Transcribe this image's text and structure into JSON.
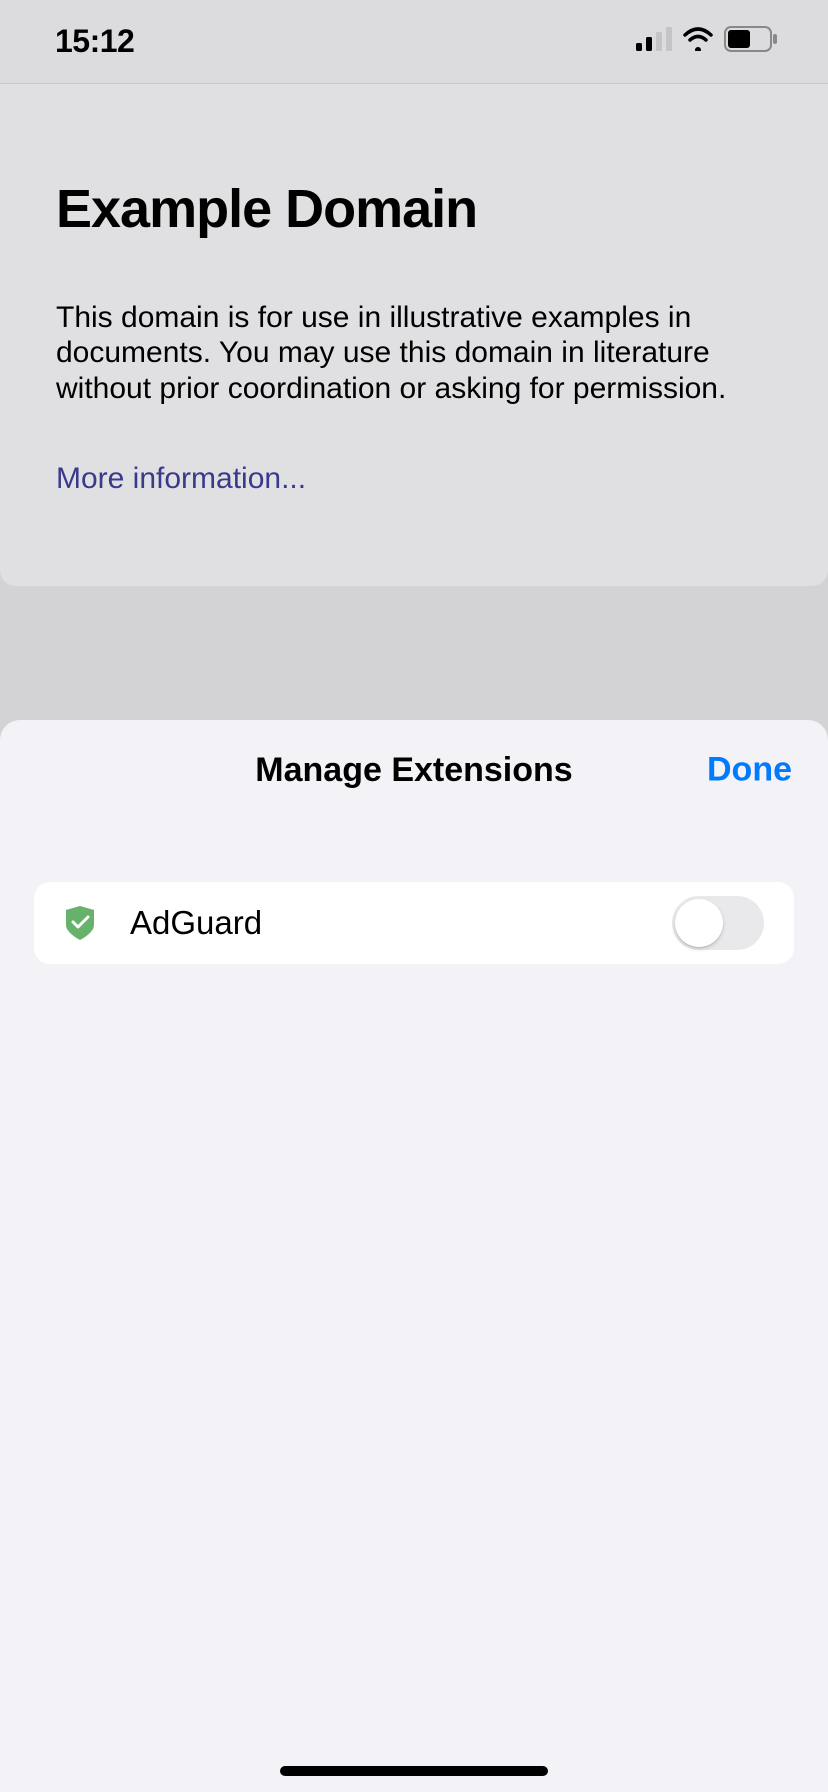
{
  "status_bar": {
    "time": "15:12"
  },
  "page": {
    "title": "Example Domain",
    "body": "This domain is for use in illustrative examples in documents. You may use this domain in literature without prior coordination or asking for permission.",
    "link_text": "More information..."
  },
  "sheet": {
    "title": "Manage Extensions",
    "done_label": "Done",
    "extensions": [
      {
        "name": "AdGuard",
        "icon": "shield-check-icon",
        "enabled": false
      }
    ]
  }
}
